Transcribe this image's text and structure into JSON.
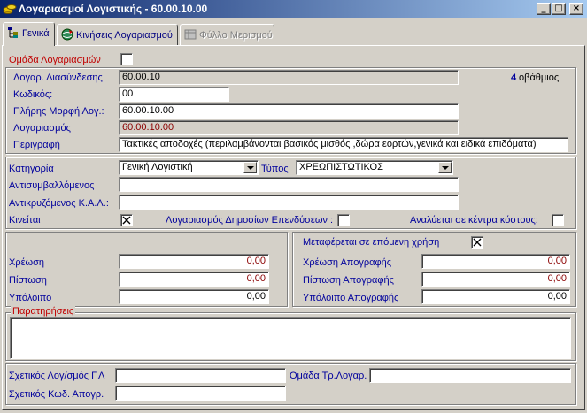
{
  "window": {
    "title": "Λογαριασμοί Λογιστικής - 60.00.10.00",
    "minimize": "_",
    "maximize": "□",
    "close": "×"
  },
  "tabs": [
    {
      "label": "Γενικά",
      "icon": "tree-icon",
      "state": "active"
    },
    {
      "label": "Κινήσεις Λογαριασμού",
      "icon": "globe-icon",
      "state": "normal"
    },
    {
      "label": "Φύλλο Μερισμού",
      "icon": "sheet-icon",
      "state": "disabled"
    }
  ],
  "account": {
    "group_label": "Ομάδα Λογαριασμών",
    "group_checked": false,
    "link_label": "Λογαρ. Διασύνδεσης",
    "link_value": "60.00.10",
    "degree_number": "4",
    "degree_label": "οβάθμιος",
    "code_label": "Κωδικός:",
    "code_value": "00",
    "full_label": "Πλήρης Μορφή Λογ.:",
    "full_value": "60.00.10.00",
    "account_label": "Λογαριασμός",
    "account_value": "60.00.10.00",
    "desc_label": "Περιγραφή",
    "desc_value": "Τακτικές αποδοχές (περιλαμβάνονται βασικός μισθός ,δώρα εορτών,γενικά και ειδικά επιδόματα)"
  },
  "classification": {
    "category_label": "Κατηγορία",
    "category_value": "Γενική Λογιστική",
    "type_label": "Τύπος",
    "type_value": "ΧΡΕΩΠΙΣΤΩΤΙΚΟΣ",
    "counterparty_label": "Αντισυμβαλλόμενος",
    "counterparty_value": "",
    "kal_label": "Αντικρυζόμενος Κ.Α.Λ.:",
    "kal_value": "",
    "moves_label": "Κινείται",
    "moves_checked": true,
    "public_label": "Λογαριασμός Δημοσίων Επενδύσεων :",
    "public_checked": false,
    "cost_label": "Αναλύεται σε κέντρα κόστους:",
    "cost_checked": false
  },
  "balances": {
    "debit_label": "Χρέωση",
    "debit_value": "0,00",
    "credit_label": "Πίστωση",
    "credit_value": "0,00",
    "balance_label": "Υπόλοιπο",
    "balance_value": "0,00"
  },
  "inventory": {
    "transfer_label": "Μεταφέρεται σε επόμενη χρήση",
    "transfer_checked": true,
    "debit_label": "Χρέωση Απογραφής",
    "debit_value": "0,00",
    "credit_label": "Πίστωση Απογραφής",
    "credit_value": "0,00",
    "balance_label": "Υπόλοιπο Απογραφής",
    "balance_value": "0,00"
  },
  "notes": {
    "legend": "Παρατηρήσεις",
    "value": ""
  },
  "related": {
    "gl_label": "Σχετικός Λογ/σμός Γ.Λ",
    "gl_value": "",
    "group_label": "Ομάδα Τρ.Λογαρ.",
    "group_value": "",
    "inv_label": "Σχετικός Κωδ. Απογρ.",
    "inv_value": ""
  },
  "colors": {
    "title_start": "#0a246a",
    "title_end": "#a6caf0",
    "label_blue": "#00009c",
    "label_red": "#c00000",
    "value_darkred": "#8b0000"
  }
}
